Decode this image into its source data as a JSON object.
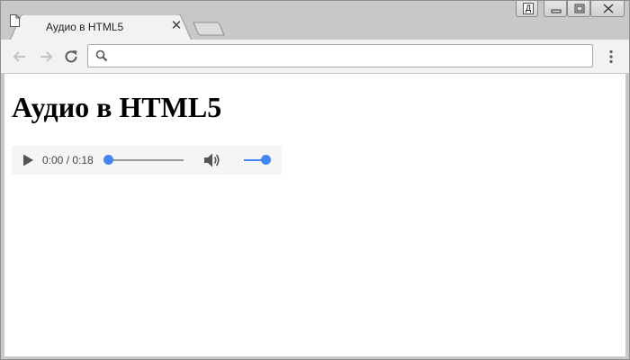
{
  "window": {
    "tab": {
      "title": "Аудио в HTML5",
      "icon": "page-icon"
    },
    "controls": {
      "user_badge": "Д"
    }
  },
  "toolbar": {
    "address": {
      "value": "",
      "placeholder": ""
    },
    "icons": [
      "back-icon",
      "forward-icon",
      "reload-icon",
      "search-icon",
      "menu-icon"
    ]
  },
  "page": {
    "heading": "Аудио в HTML5",
    "audio": {
      "time": "0:00 / 0:18",
      "progress_fraction": 0,
      "volume_fraction": 1,
      "accent_color": "#4285f4"
    }
  }
}
